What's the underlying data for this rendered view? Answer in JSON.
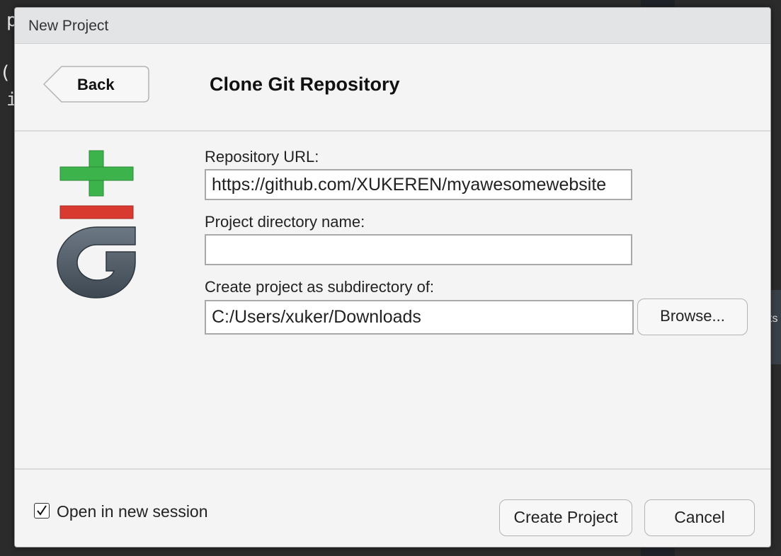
{
  "window": {
    "title": "New Project"
  },
  "header": {
    "back_label": "Back",
    "title": "Clone Git Repository"
  },
  "form": {
    "repo_url": {
      "label": "Repository URL:",
      "value": "https://github.com/XUKEREN/myawesomewebsite"
    },
    "project_dir": {
      "label": "Project directory name:",
      "value": ""
    },
    "parent_dir": {
      "label": "Create project as subdirectory of:",
      "value": "C:/Users/xuker/Downloads"
    },
    "browse_label": "Browse..."
  },
  "footer": {
    "open_new_session_label": "Open in new session",
    "open_new_session_checked": true,
    "create_label": "Create Project",
    "cancel_label": "Cancel"
  },
  "background": {
    "code_fragments": [
      "p",
      "p(",
      "i"
    ],
    "tab_fragment": "ts"
  },
  "icons": {
    "back": "back-arrow-icon",
    "logo": "git-logo-icon",
    "checkbox": "checkmark-icon"
  },
  "colors": {
    "dialog_bg": "#f3f4f3",
    "titlebar_bg": "#e3e4e5",
    "git_green": "#3cb44b",
    "git_red": "#d93a30",
    "git_grey": "#4d5a66"
  }
}
